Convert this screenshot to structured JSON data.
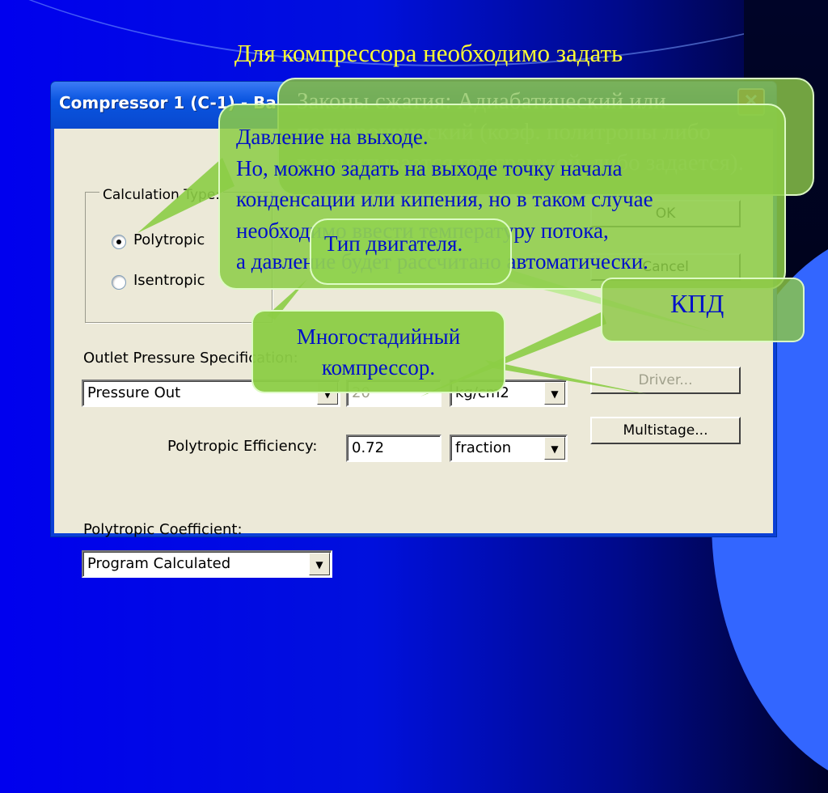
{
  "slide": {
    "title": "Для компрессора необходимо задать"
  },
  "dialog": {
    "title": "Compressor 1 (C-1) - Ba",
    "close_glyph": "✕",
    "calculation_type": {
      "label": "Calculation Type:",
      "options": [
        {
          "label": "Polytropic",
          "checked": true
        },
        {
          "label": "Isentropic",
          "checked": false
        }
      ]
    },
    "outlet_pressure": {
      "label": "Outlet Pressure Specification:",
      "spec_value": "Pressure Out",
      "pressure_value": "20",
      "pressure_unit": "kg/cm2"
    },
    "efficiency": {
      "label": "Polytropic Efficiency:",
      "value": "0.72",
      "unit": "fraction"
    },
    "coefficient": {
      "label": "Polytropic Coefficient:",
      "value": "Program Calculated"
    },
    "buttons": {
      "ok": "OK",
      "cancel": "Cancel",
      "driver": "Driver...",
      "multistage": "Multistage..."
    },
    "dropdown_glyph": "▼"
  },
  "callouts": {
    "compression_laws": "Законы сжатия: Адиабатический или\nполитропический (коэф. политропы либо\nрассчитывается программой, либо задается).",
    "outlet_pressure": "Давление на выходе.\nНо, можно задать на выходе точку начала\nконденсации или кипения, но в таком случае\nнеобходимо ввести температуру потока,\nа давление будет рассчитано автоматически.",
    "driver_type": "Тип двигателя.",
    "efficiency": "КПД",
    "multistage": "Многостадийный\nкомпрессор."
  },
  "colors": {
    "title_yellow": "#ffff33",
    "callout_text": "#0010c8",
    "callout_fill": "#8ccd46",
    "dialog_face": "#ece9d8",
    "titlebar_blue": "#0a55e0"
  }
}
